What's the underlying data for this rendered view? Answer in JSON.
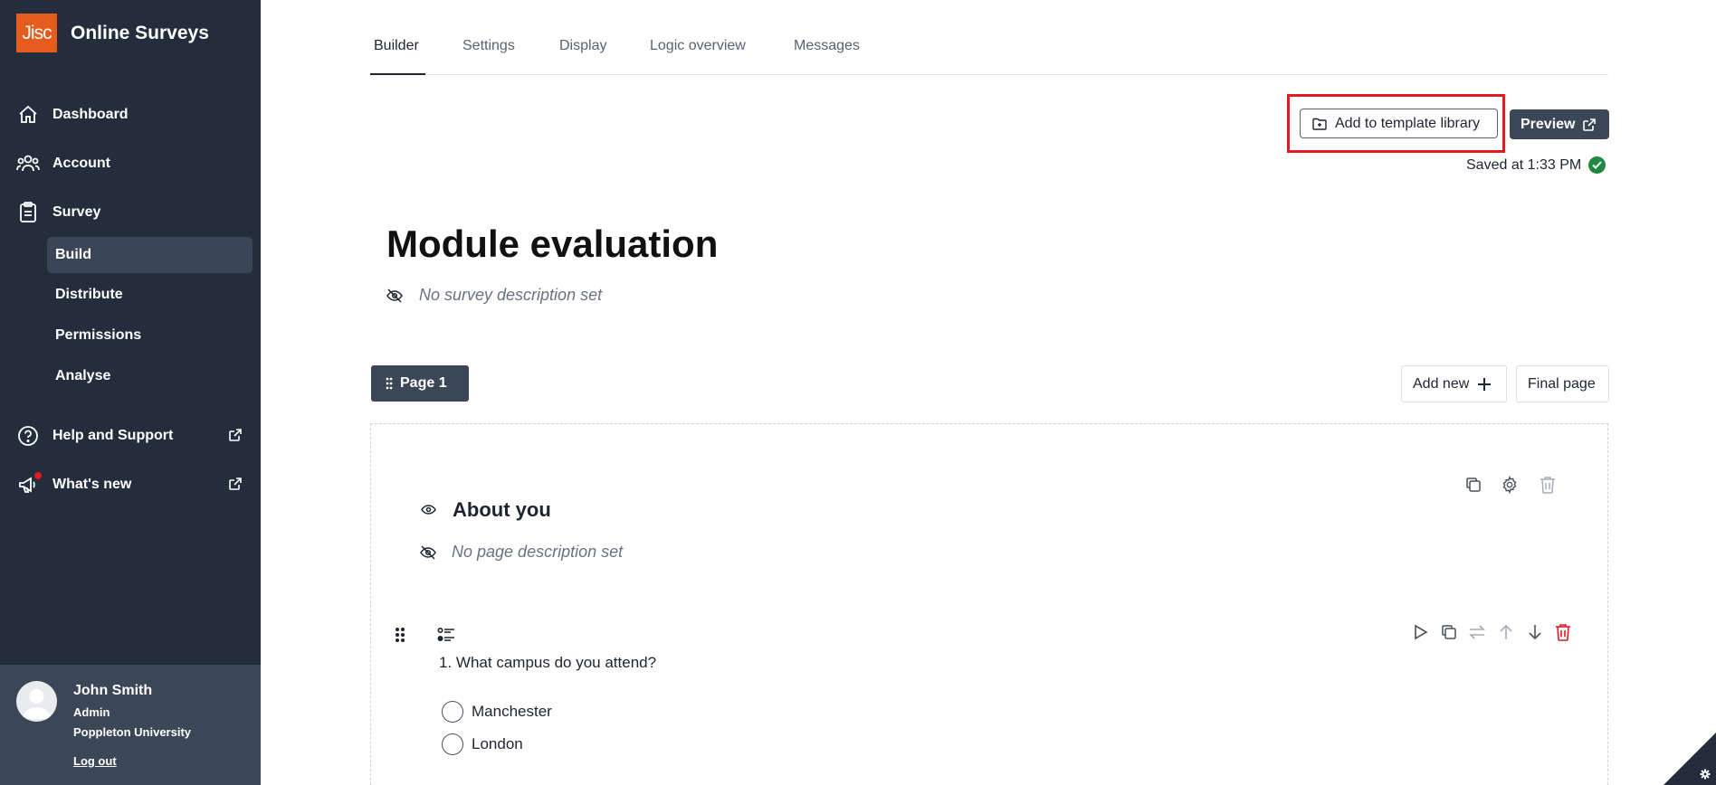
{
  "brand": {
    "logo_text": "Jisc",
    "name": "Online Surveys",
    "logo_color": "#e65c1c"
  },
  "sidebar": {
    "items": [
      {
        "label": "Dashboard",
        "icon": "home-icon"
      },
      {
        "label": "Account",
        "icon": "users-icon"
      },
      {
        "label": "Survey",
        "icon": "clipboard-icon"
      }
    ],
    "sub_items": [
      {
        "label": "Build",
        "active": true
      },
      {
        "label": "Distribute"
      },
      {
        "label": "Permissions"
      },
      {
        "label": "Analyse"
      }
    ],
    "help": {
      "label": "Help and Support",
      "icon": "help-circle-icon"
    },
    "whats_new": {
      "label": "What's new",
      "icon": "megaphone-icon"
    },
    "background": "#232d3c"
  },
  "user": {
    "name": "John Smith",
    "role": "Admin",
    "org": "Poppleton University",
    "logout": "Log out"
  },
  "tabs": [
    "Builder",
    "Settings",
    "Display",
    "Logic overview",
    "Messages"
  ],
  "toolbar": {
    "template_label": "Add to template library",
    "preview_label": "Preview",
    "saved_text": "Saved at 1:33 PM"
  },
  "survey": {
    "title": "Module evaluation",
    "description_placeholder": "No survey description set"
  },
  "page_controls": {
    "page_label": "Page 1",
    "add_new_label": "Add new",
    "final_page_label": "Final page"
  },
  "page": {
    "title": "About you",
    "description_placeholder": "No page description set"
  },
  "question": {
    "number": "1.",
    "text": "What campus do you attend?",
    "options": [
      "Manchester",
      "London"
    ]
  },
  "colors": {
    "accent": "#3b4657",
    "highlight": "#e11b22",
    "success": "#1f8a3f",
    "danger": "#e11b22"
  }
}
